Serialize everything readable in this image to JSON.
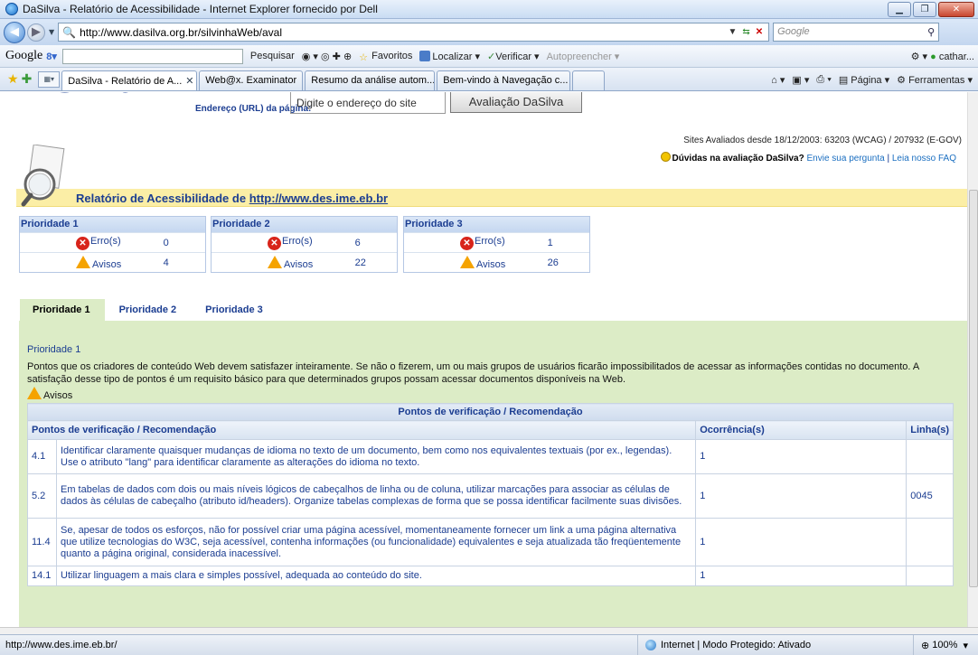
{
  "window": {
    "title": "DaSilva - Relatório de Acessibilidade - Internet Explorer fornecido por Dell"
  },
  "address": {
    "url": "http://www.dasilva.org.br/silvinhaWeb/aval",
    "search_placeholder": "Google"
  },
  "googlebar": {
    "logo": "Google",
    "items": [
      "Pesquisar",
      "Favoritos",
      "Localizar",
      "Verificar",
      "Autopreencher",
      "cathar..."
    ]
  },
  "browser_tabs": [
    {
      "label": "DaSilva - Relatório de A...",
      "active": true
    },
    {
      "label": "Web@x. Examinator",
      "active": false
    },
    {
      "label": "Resumo da análise autom...",
      "active": false
    },
    {
      "label": "Bem-vindo à Navegação c...",
      "active": false
    }
  ],
  "commandbar": {
    "page": "Página",
    "tools": "Ferramentas"
  },
  "site": {
    "logo_text": "silva",
    "url_label": "Endereço (URL) da página:",
    "url_input_placeholder": "Digite o endereço do site",
    "aval_button": "Avaliação DaSilva",
    "stats": "Sites Avaliados desde 18/12/2003: 63203 (WCAG) / 207932 (E-GOV)",
    "faq_question": "Dúvidas na avaliação DaSilva?",
    "faq_send": "Envie sua pergunta",
    "faq_sep": "|",
    "faq_link": "Leia nosso FAQ",
    "report_title_prefix": "Relatório de Acessibilidade de",
    "report_url": "http://www.des.ime.eb.br"
  },
  "priorities": [
    {
      "title": "Prioridade 1",
      "errors_label": "Erro(s)",
      "errors": "0",
      "warnings_label": "Avisos",
      "warnings": "4"
    },
    {
      "title": "Prioridade 2",
      "errors_label": "Erro(s)",
      "errors": "6",
      "warnings_label": "Avisos",
      "warnings": "22"
    },
    {
      "title": "Prioridade 3",
      "errors_label": "Erro(s)",
      "errors": "1",
      "warnings_label": "Avisos",
      "warnings": "26"
    }
  ],
  "priority_tabs": [
    "Prioridade 1",
    "Prioridade 2",
    "Prioridade 3"
  ],
  "panel": {
    "heading": "Prioridade 1",
    "description": "Pontos que os criadores de conteúdo Web devem satisfazer inteiramente. Se não o fizerem, um ou mais grupos de usuários ficarão impossibilitados de acessar as informações contidas no documento. A satisfação desse tipo de pontos é um requisito básico para que determinados grupos possam acessar documentos disponíveis na Web.",
    "avisos_label": "Avisos",
    "table_caption": "Pontos de verificação / Recomendação",
    "col_points": "Pontos de verificação / Recomendação",
    "col_occ": "Ocorrência(s)",
    "col_lines": "Linha(s)",
    "rows": [
      {
        "code": "4.1",
        "text": "Identificar claramente quaisquer mudanças de idioma no texto de um documento, bem como nos equivalentes textuais (por ex., legendas). Use o atributo \"lang\" para identificar claramente as alterações do idioma no texto.",
        "occ": "1",
        "lines": ""
      },
      {
        "code": "5.2",
        "text": "Em tabelas de dados com dois ou mais níveis lógicos de cabeçalhos de linha ou de coluna, utilizar marcações para associar as células de dados às células de cabeçalho (atributo id/headers). Organize tabelas complexas de forma que se possa identificar facilmente suas divisões.",
        "occ": "1",
        "lines": "0045"
      },
      {
        "code": "11.4",
        "text": "Se, apesar de todos os esforços, não for possível criar uma página acessível, momentaneamente fornecer um link a uma página alternativa que utilize tecnologias do W3C, seja acessível, contenha informações (ou funcionalidade) equivalentes e seja atualizada tão freqüentemente quanto a página original, considerada inacessível.",
        "occ": "1",
        "lines": ""
      },
      {
        "code": "14.1",
        "text": "Utilizar linguagem a mais clara e simples possível, adequada ao conteúdo do site.",
        "occ": "1",
        "lines": ""
      }
    ]
  },
  "status": {
    "url": "http://www.des.ime.eb.br/",
    "zone": "Internet | Modo Protegido: Ativado",
    "zoom": "100%"
  }
}
